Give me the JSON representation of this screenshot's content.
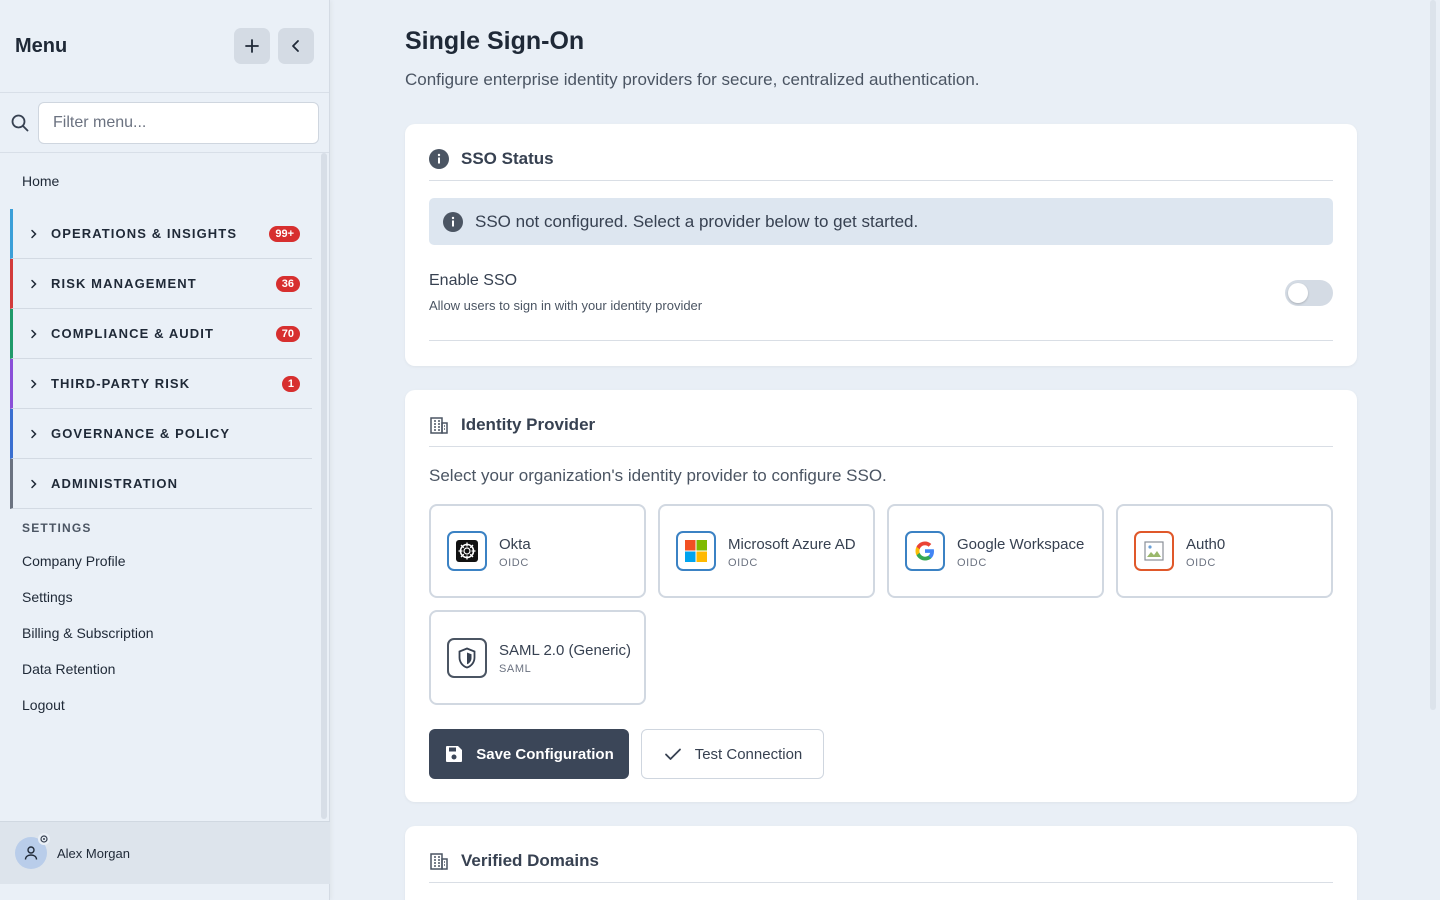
{
  "sidebar": {
    "title": "Menu",
    "filter_placeholder": "Filter menu...",
    "home": "Home",
    "groups": [
      {
        "label": "OPERATIONS & INSIGHTS",
        "badge": "99+",
        "color": "#3b9fd8"
      },
      {
        "label": "RISK MANAGEMENT",
        "badge": "36",
        "color": "#d23b3b"
      },
      {
        "label": "COMPLIANCE & AUDIT",
        "badge": "70",
        "color": "#1f9a6a"
      },
      {
        "label": "THIRD-PARTY RISK",
        "badge": "1",
        "color": "#8a4fd8"
      },
      {
        "label": "GOVERNANCE & POLICY",
        "badge": "",
        "color": "#3a6fd0"
      },
      {
        "label": "ADMINISTRATION",
        "badge": "",
        "color": "#6b7280"
      }
    ],
    "settings_label": "SETTINGS",
    "settings_items": [
      "Company Profile",
      "Settings",
      "Billing & Subscription",
      "Data Retention",
      "Logout"
    ],
    "user": {
      "name": "Alex Morgan"
    }
  },
  "page": {
    "title": "Single Sign-On",
    "subtitle": "Configure enterprise identity providers for secure, centralized authentication."
  },
  "sso_status": {
    "title": "SSO Status",
    "alert": "SSO not configured. Select a provider below to get started.",
    "enable_label": "Enable SSO",
    "enable_desc": "Allow users to sign in with your identity provider",
    "enabled": false
  },
  "identity_provider": {
    "title": "Identity Provider",
    "description": "Select your organization's identity provider to configure SSO.",
    "providers": [
      {
        "name": "Okta",
        "protocol": "OIDC",
        "icon": "okta-icon"
      },
      {
        "name": "Microsoft Azure AD",
        "protocol": "OIDC",
        "icon": "microsoft-icon"
      },
      {
        "name": "Google Workspace",
        "protocol": "OIDC",
        "icon": "google-icon"
      },
      {
        "name": "Auth0",
        "protocol": "OIDC",
        "icon": "broken-image-icon"
      },
      {
        "name": "SAML 2.0 (Generic)",
        "protocol": "SAML",
        "icon": "shield-icon"
      }
    ],
    "save_label": "Save Configuration",
    "test_label": "Test Connection"
  },
  "verified_domains": {
    "title": "Verified Domains"
  }
}
